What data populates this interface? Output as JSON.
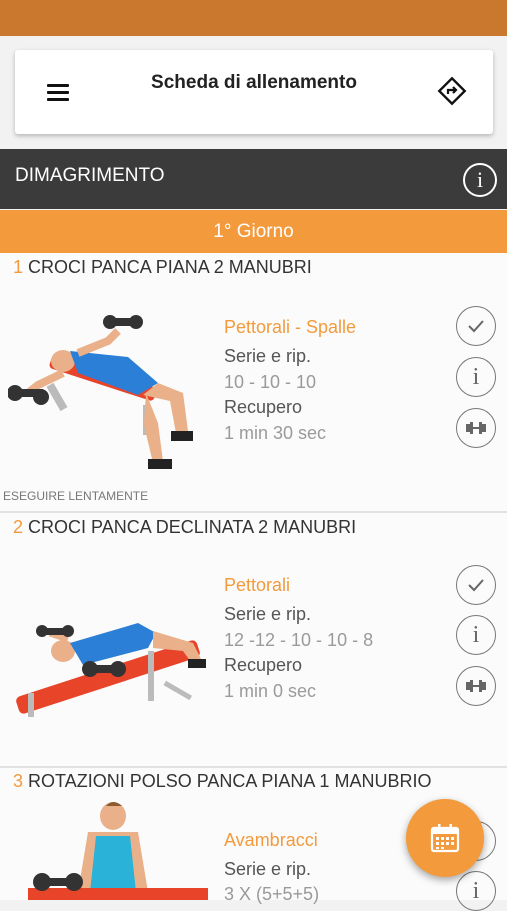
{
  "toolbar": {
    "title": "Scheda di allenamento",
    "menu_icon": "hamburger-icon",
    "nav_icon": "directions-icon"
  },
  "section": {
    "title": "DIMAGRIMENTO"
  },
  "day": {
    "label": "1° Giorno"
  },
  "exercises": [
    {
      "num": "1",
      "name": "CROCI PANCA PIANA 2 MANUBRI",
      "muscles": "Pettorali - Spalle",
      "sets_label": "Serie e rip.",
      "sets": "10 - 10 - 10",
      "rest_label": "Recupero",
      "rest": "1 min 30 sec",
      "note": "ESEGUIRE LENTAMENTE"
    },
    {
      "num": "2",
      "name": "CROCI PANCA DECLINATA 2 MANUBRI",
      "muscles": "Pettorali",
      "sets_label": "Serie e rip.",
      "sets": "12 -12 - 10 - 10 - 8",
      "rest_label": "Recupero",
      "rest": "1 min 0 sec"
    },
    {
      "num": "3",
      "name": "ROTAZIONI POLSO PANCA PIANA 1 MANUBRIO",
      "muscles": "Avambracci",
      "sets_label": "Serie e rip.",
      "sets": "3 X (5+5+5)"
    }
  ],
  "colors": {
    "accent": "#f39a3c",
    "status": "#c9782e",
    "header": "#3b3b3b"
  }
}
